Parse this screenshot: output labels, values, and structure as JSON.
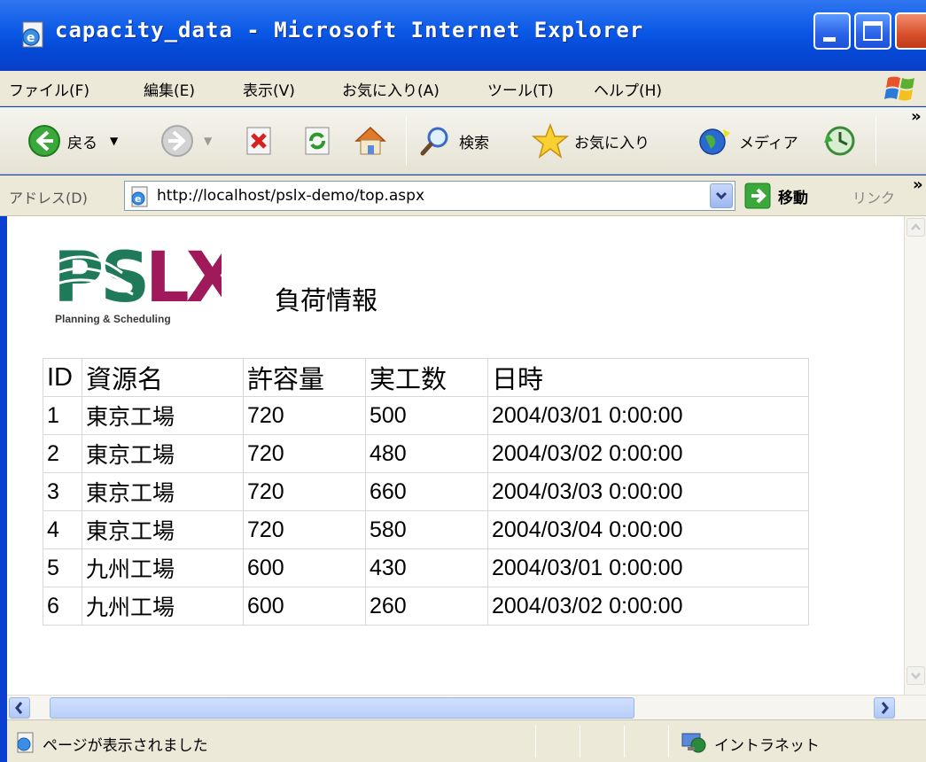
{
  "window": {
    "title": "capacity_data - Microsoft Internet Explorer"
  },
  "menu": [
    "ファイル(F)",
    "編集(E)",
    "表示(V)",
    "お気に入り(A)",
    "ツール(T)",
    "ヘルプ(H)"
  ],
  "toolbar": {
    "back_label": "戻る",
    "search_label": "検索",
    "favorites_label": "お気に入り",
    "media_label": "メディア"
  },
  "address": {
    "label": "アドレス(D)",
    "url": "http://localhost/pslx-demo/top.aspx",
    "go_label": "移動",
    "links_label": "リンク"
  },
  "page": {
    "heading": "負荷情報",
    "logo_text": "PSLX",
    "logo_tagline": "Planning & Scheduling",
    "table": {
      "headers": [
        "ID",
        "資源名",
        "許容量",
        "実工数",
        "日時"
      ],
      "rows": [
        [
          "1",
          "東京工場",
          "720",
          "500",
          "2004/03/01 0:00:00"
        ],
        [
          "2",
          "東京工場",
          "720",
          "480",
          "2004/03/02 0:00:00"
        ],
        [
          "3",
          "東京工場",
          "720",
          "660",
          "2004/03/03 0:00:00"
        ],
        [
          "4",
          "東京工場",
          "720",
          "580",
          "2004/03/04 0:00:00"
        ],
        [
          "5",
          "九州工場",
          "600",
          "430",
          "2004/03/01 0:00:00"
        ],
        [
          "6",
          "九州工場",
          "600",
          "260",
          "2004/03/02 0:00:00"
        ]
      ]
    }
  },
  "status": {
    "text": "ページが表示されました",
    "zone": "イントラネット"
  },
  "colors": {
    "titlebar": "#0b58e6",
    "chrome": "#ece9d8",
    "logo_green": "#1f7a5a",
    "logo_magenta": "#a0195a"
  }
}
